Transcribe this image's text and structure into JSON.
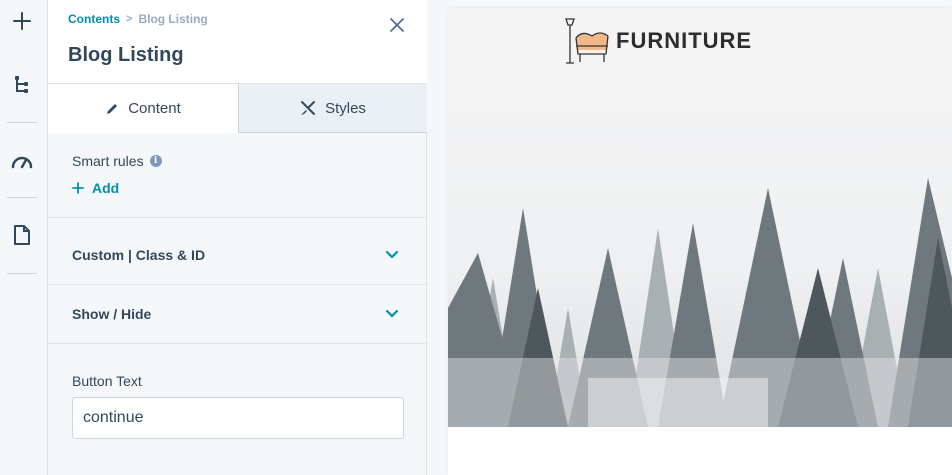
{
  "rail": {
    "items": [
      {
        "icon": "plus-icon"
      },
      {
        "icon": "tree-structure-icon"
      },
      {
        "icon": "speedometer-icon"
      },
      {
        "icon": "document-icon"
      }
    ]
  },
  "panel": {
    "breadcrumb": {
      "parent": "Contents",
      "separator": ">",
      "current": "Blog Listing"
    },
    "title": "Blog Listing",
    "tabs": [
      {
        "label": "Content",
        "icon": "pencil-icon",
        "active": true
      },
      {
        "label": "Styles",
        "icon": "brush-icon",
        "active": false
      }
    ],
    "smart_rules": {
      "label": "Smart rules",
      "add_label": "Add"
    },
    "sections": [
      {
        "label": "Custom | Class & ID"
      },
      {
        "label": "Show / Hide"
      }
    ],
    "button_text": {
      "label": "Button Text",
      "value": "continue"
    }
  },
  "preview": {
    "logo_text": "FURNITURE"
  },
  "colors": {
    "accent": "#0091ae",
    "text": "#33475b",
    "muted": "#99acc2"
  }
}
